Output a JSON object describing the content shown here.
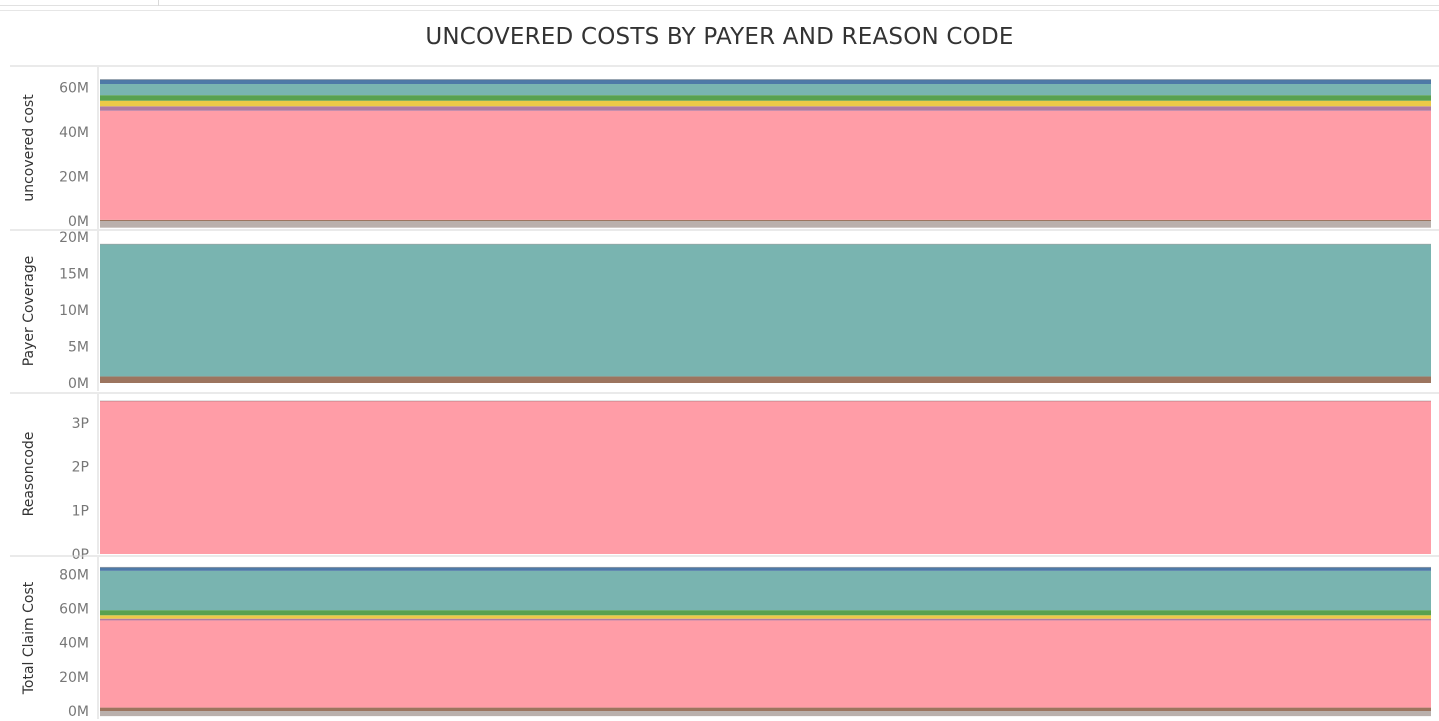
{
  "title": "UNCOVERED COSTS BY PAYER AND REASON CODE",
  "colors": {
    "pink": "#ff9da7",
    "teal": "#79b4b0",
    "blue": "#4e79a7",
    "green": "#59a14f",
    "yellow": "#edc948",
    "purple": "#b07aa1",
    "brown": "#9c755f",
    "gray": "#bab0ac"
  },
  "chart_data": [
    {
      "type": "area",
      "ylabel": "uncovered cost",
      "ylim": [
        0,
        66
      ],
      "ticks": [
        {
          "v": 0,
          "label": "0M"
        },
        {
          "v": 20,
          "label": "20M"
        },
        {
          "v": 40,
          "label": "40M"
        },
        {
          "v": 60,
          "label": "60M"
        }
      ],
      "series": [
        {
          "color": "gray",
          "value": -3
        },
        {
          "color": "brown",
          "value": 0.5
        },
        {
          "color": "pink",
          "value": 49
        },
        {
          "color": "purple",
          "value": 2
        },
        {
          "color": "yellow",
          "value": 2.5
        },
        {
          "color": "green",
          "value": 2.5
        },
        {
          "color": "teal",
          "value": 5
        },
        {
          "color": "blue",
          "value": 2
        }
      ]
    },
    {
      "type": "area",
      "ylabel": "Payer Coverage",
      "ylim": [
        0,
        20
      ],
      "ticks": [
        {
          "v": 0,
          "label": "0M"
        },
        {
          "v": 5,
          "label": "5M"
        },
        {
          "v": 10,
          "label": "10M"
        },
        {
          "v": 15,
          "label": "15M"
        },
        {
          "v": 20,
          "label": "20M"
        }
      ],
      "series": [
        {
          "color": "brown",
          "value": 0.9
        },
        {
          "color": "teal",
          "value": 18.1
        }
      ]
    },
    {
      "type": "area",
      "ylabel": "Reasoncode",
      "ylim": [
        0,
        3.5
      ],
      "ticks": [
        {
          "v": 0,
          "label": "0P"
        },
        {
          "v": 1,
          "label": "1P"
        },
        {
          "v": 2,
          "label": "2P"
        },
        {
          "v": 3,
          "label": "3P"
        }
      ],
      "series": [
        {
          "color": "pink",
          "value": 3.5
        }
      ]
    },
    {
      "type": "area",
      "ylabel": "Total Claim Cost",
      "ylim": [
        0,
        86
      ],
      "ticks": [
        {
          "v": 0,
          "label": "0M"
        },
        {
          "v": 20,
          "label": "20M"
        },
        {
          "v": 40,
          "label": "40M"
        },
        {
          "v": 60,
          "label": "60M"
        },
        {
          "v": 80,
          "label": "80M"
        }
      ],
      "series": [
        {
          "color": "gray",
          "value": -3
        },
        {
          "color": "brown",
          "value": 2
        },
        {
          "color": "pink",
          "value": 51
        },
        {
          "color": "purple",
          "value": 1
        },
        {
          "color": "yellow",
          "value": 2
        },
        {
          "color": "green",
          "value": 3
        },
        {
          "color": "teal",
          "value": 23
        },
        {
          "color": "blue",
          "value": 2
        }
      ]
    }
  ]
}
